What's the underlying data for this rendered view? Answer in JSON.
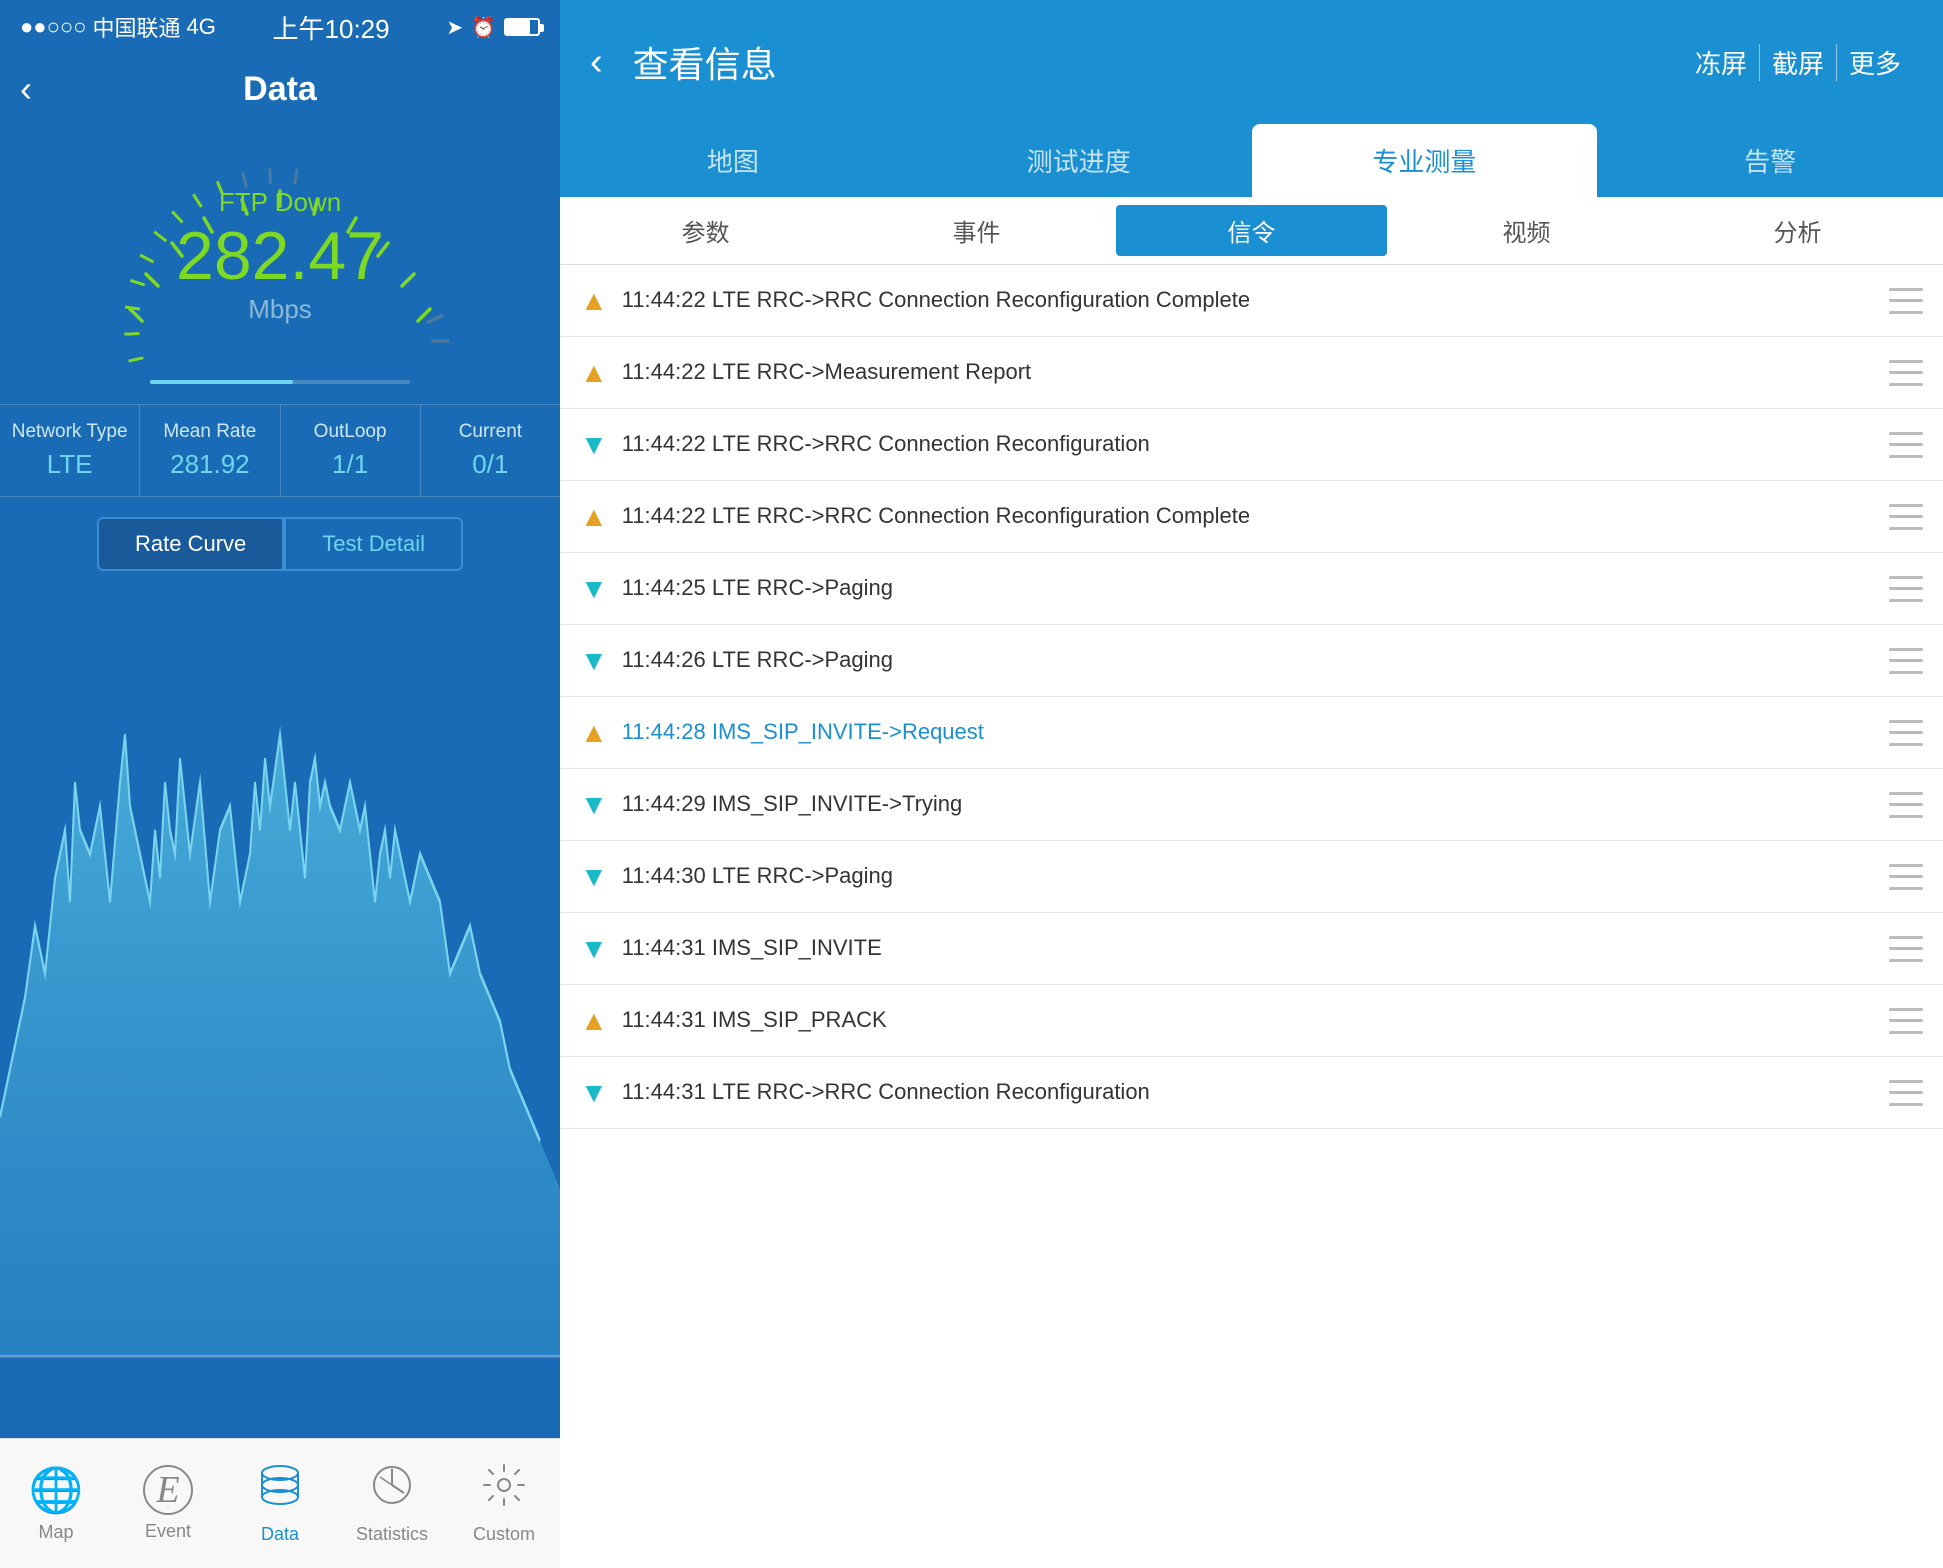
{
  "left": {
    "statusBar": {
      "carrier": "中国联通",
      "network": "4G",
      "time": "上午10:29",
      "title": "Data"
    },
    "gauge": {
      "label": "FTP Down",
      "value": "282.47",
      "unit": "Mbps"
    },
    "stats": [
      {
        "label": "Network Type",
        "value": "LTE"
      },
      {
        "label": "Mean Rate",
        "value": "281.92"
      },
      {
        "label": "OutLoop",
        "value": "1/1"
      },
      {
        "label": "Current",
        "value": "0/1"
      }
    ],
    "tabs": [
      {
        "label": "Rate Curve",
        "active": true
      },
      {
        "label": "Test Detail",
        "active": false
      }
    ],
    "bottomNav": [
      {
        "label": "Map",
        "icon": "🌐",
        "active": false
      },
      {
        "label": "Event",
        "icon": "Ⓔ",
        "active": false
      },
      {
        "label": "Data",
        "icon": "🗄",
        "active": true
      },
      {
        "label": "Statistics",
        "icon": "📊",
        "active": false
      },
      {
        "label": "Custom",
        "icon": "⚙",
        "active": false
      }
    ]
  },
  "right": {
    "header": {
      "title": "查看信息",
      "actions": [
        "冻屏",
        "截屏",
        "更多"
      ]
    },
    "tabs1": [
      "地图",
      "测试进度",
      "专业测量",
      "告警"
    ],
    "tabs1Active": 2,
    "tabs2": [
      "参数",
      "事件",
      "信令",
      "视频",
      "分析"
    ],
    "tabs2Active": 2,
    "signals": [
      {
        "direction": "up",
        "time": "11:44:22",
        "text": "LTE RRC->RRC Connection Reconfiguration Complete",
        "highlight": false
      },
      {
        "direction": "up",
        "time": "11:44:22",
        "text": "LTE RRC->Measurement Report",
        "highlight": false
      },
      {
        "direction": "down",
        "time": "11:44:22",
        "text": "LTE RRC->RRC Connection Reconfiguration",
        "highlight": false
      },
      {
        "direction": "up",
        "time": "11:44:22",
        "text": "LTE RRC->RRC Connection Reconfiguration Complete",
        "highlight": false
      },
      {
        "direction": "down",
        "time": "11:44:25",
        "text": "LTE RRC->Paging",
        "highlight": false
      },
      {
        "direction": "down",
        "time": "11:44:26",
        "text": "LTE RRC->Paging",
        "highlight": false
      },
      {
        "direction": "up",
        "time": "11:44:28",
        "text": "IMS_SIP_INVITE->Request",
        "highlight": true
      },
      {
        "direction": "down",
        "time": "11:44:29",
        "text": "IMS_SIP_INVITE->Trying",
        "highlight": false
      },
      {
        "direction": "down",
        "time": "11:44:30",
        "text": "LTE RRC->Paging",
        "highlight": false
      },
      {
        "direction": "down",
        "time": "11:44:31",
        "text": "IMS_SIP_INVITE",
        "highlight": false
      },
      {
        "direction": "up",
        "time": "11:44:31",
        "text": "IMS_SIP_PRACK",
        "highlight": false
      },
      {
        "direction": "down",
        "time": "11:44:31",
        "text": "LTE RRC->RRC Connection Reconfiguration",
        "highlight": false
      }
    ]
  }
}
